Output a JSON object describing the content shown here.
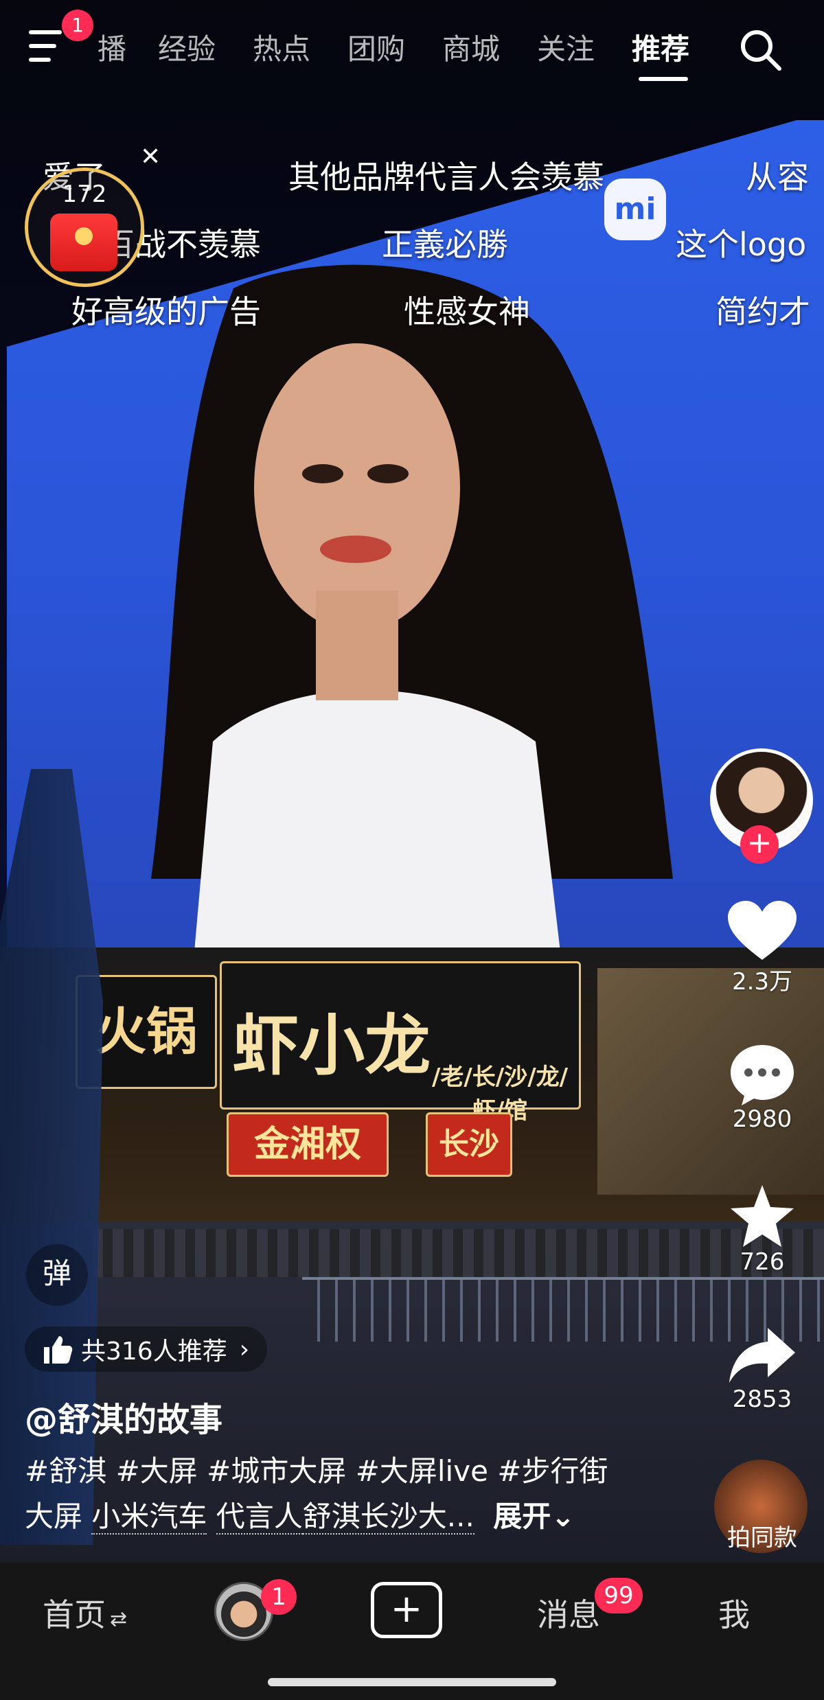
{
  "top_nav": {
    "menu_badge": "1",
    "tabs": [
      "播",
      "经验",
      "热点",
      "团购",
      "商城",
      "关注",
      "推荐"
    ],
    "active_tab": "推荐"
  },
  "danmaku": [
    "爱了",
    "其他品牌代言人会羡慕",
    "从容",
    "百战不羡慕",
    "正義必勝",
    "这个logo",
    "好高级的广告",
    "性感女神",
    "简约才"
  ],
  "red_packet": {
    "count": "172"
  },
  "video_signs": {
    "hotpot": "火锅",
    "xiaolong": "虾小龙",
    "jinxiang": "金湘权",
    "changsha": "长沙",
    "xiaolong_sub": "/老/长/沙/龙/虾/馆"
  },
  "actions": {
    "like_count": "2.3万",
    "comment_count": "2980",
    "favorite_count": "726",
    "share_count": "2853",
    "same_style_label": "拍同款"
  },
  "info": {
    "barrage_label": "弹",
    "recommend_text": "共316人推荐",
    "author": "@舒淇的故事",
    "tags": [
      "#舒淇",
      "#大屏",
      "#城市大屏",
      "#大屏live",
      "#步行街"
    ],
    "desc_line2_prefix": "大屏",
    "desc_link1": "小米汽车",
    "desc_link2": "代言人",
    "desc_link3": "舒淇长沙大...",
    "expand": "展开"
  },
  "bottom_bar": {
    "home": "首页",
    "friends_badge": "1",
    "messages": "消息",
    "messages_badge": "99",
    "me": "我"
  },
  "colors": {
    "accent": "#fe2c55",
    "gold": "#f0c25a"
  }
}
